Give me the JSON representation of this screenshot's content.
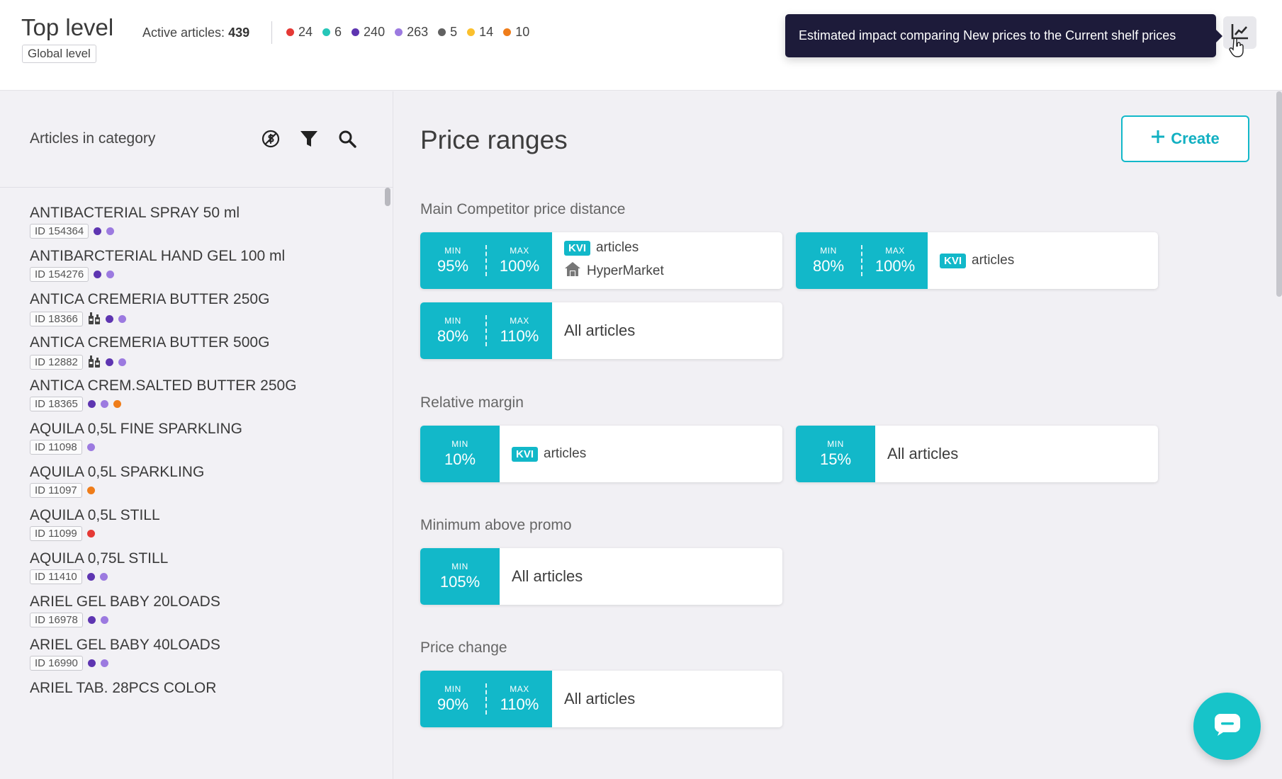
{
  "header": {
    "title": "Top level",
    "level_badge": "Global level",
    "active_label": "Active articles:",
    "active_count": "439",
    "counts": [
      {
        "value": "24",
        "color": "#e53935"
      },
      {
        "value": "6",
        "color": "#26c6b8"
      },
      {
        "value": "240",
        "color": "#5e35b1"
      },
      {
        "value": "263",
        "color": "#9c7ae0"
      },
      {
        "value": "5",
        "color": "#616161"
      },
      {
        "value": "14",
        "color": "#fbc02d"
      },
      {
        "value": "10",
        "color": "#ef7d1a"
      }
    ],
    "tooltip": "Estimated impact comparing New prices to the Current shelf prices",
    "impact_icon": "chart-line-icon"
  },
  "sidebar": {
    "title": "Articles in category",
    "icons": [
      "currency-toggle-icon",
      "filter-icon",
      "search-icon"
    ],
    "articles": [
      {
        "name": "ANTIBACTERIAL SPRAY 50 ml",
        "id": "ID 154364",
        "bundle": false,
        "dots": [
          "#5e35b1",
          "#9c7ae0"
        ]
      },
      {
        "name": "ANTIBARCTERIAL HAND GEL 100 ml",
        "id": "ID 154276",
        "bundle": false,
        "dots": [
          "#5e35b1",
          "#9c7ae0"
        ]
      },
      {
        "name": "ANTICA CREMERIA BUTTER 250G",
        "id": "ID 18366",
        "bundle": true,
        "dots": [
          "#5e35b1",
          "#9c7ae0"
        ]
      },
      {
        "name": "ANTICA CREMERIA BUTTER 500G",
        "id": "ID 12882",
        "bundle": true,
        "dots": [
          "#5e35b1",
          "#9c7ae0"
        ]
      },
      {
        "name": "ANTICA CREM.SALTED BUTTER 250G",
        "id": "ID 18365",
        "bundle": false,
        "dots": [
          "#5e35b1",
          "#9c7ae0",
          "#ef7d1a"
        ]
      },
      {
        "name": "AQUILA 0,5L FINE SPARKLING",
        "id": "ID 11098",
        "bundle": false,
        "dots": [
          "#9c7ae0"
        ]
      },
      {
        "name": "AQUILA 0,5L SPARKLING",
        "id": "ID 11097",
        "bundle": false,
        "dots": [
          "#ef7d1a"
        ]
      },
      {
        "name": "AQUILA 0,5L STILL",
        "id": "ID 11099",
        "bundle": false,
        "dots": [
          "#e53935"
        ]
      },
      {
        "name": "AQUILA 0,75L STILL",
        "id": "ID 11410",
        "bundle": false,
        "dots": [
          "#5e35b1",
          "#9c7ae0"
        ]
      },
      {
        "name": "ARIEL GEL BABY 20LOADS",
        "id": "ID 16978",
        "bundle": false,
        "dots": [
          "#5e35b1",
          "#9c7ae0"
        ]
      },
      {
        "name": "ARIEL GEL BABY 40LOADS",
        "id": "ID 16990",
        "bundle": false,
        "dots": [
          "#5e35b1",
          "#9c7ae0"
        ]
      },
      {
        "name": "ARIEL TAB. 28PCS COLOR",
        "id": "",
        "bundle": false,
        "dots": []
      }
    ]
  },
  "main": {
    "title": "Price ranges",
    "create_label": "Create",
    "sections": {
      "competitor": "Main Competitor price distance",
      "margin": "Relative margin",
      "promo": "Minimum above promo",
      "change": "Price change"
    },
    "labels": {
      "min": "MIN",
      "max": "MAX",
      "kvi": "KVI",
      "articles": "articles",
      "all_articles": "All articles",
      "hypermarket": "HyperMarket"
    },
    "rules": {
      "c1": {
        "min": "95%",
        "max": "100%"
      },
      "c2": {
        "min": "80%",
        "max": "100%"
      },
      "c3": {
        "min": "80%",
        "max": "110%"
      },
      "m1": {
        "min": "10%"
      },
      "m2": {
        "min": "15%"
      },
      "p1": {
        "min": "105%"
      },
      "ch1": {
        "min": "90%",
        "max": "110%"
      }
    },
    "accent_color": "#12b8c9"
  }
}
